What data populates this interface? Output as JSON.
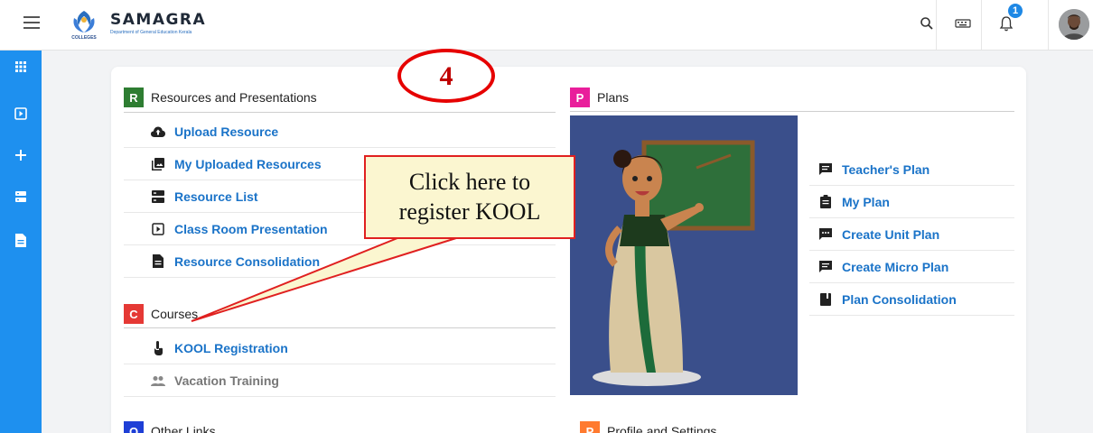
{
  "header": {
    "brand_title": "SAMAGRA",
    "brand_sub": "Department of General Education Kerala",
    "logo_caption": "COLLEGES",
    "notification_count": "1",
    "icons": [
      "search-icon",
      "keyboard-icon",
      "bell-icon"
    ]
  },
  "sidebar": {
    "items": [
      "apps-icon",
      "presentation-icon",
      "plus-icon",
      "list-icon",
      "document-icon"
    ]
  },
  "sections": {
    "resources": {
      "letter": "R",
      "title": "Resources and Presentations",
      "color": "#2e7d32"
    },
    "plans": {
      "letter": "P",
      "title": "Plans",
      "color": "#e91e9b"
    },
    "courses": {
      "letter": "C",
      "title": "Courses",
      "color": "#e53935"
    },
    "other": {
      "letter": "O",
      "title": "Other Links",
      "color": "#1e3fd6"
    },
    "profile": {
      "letter": "P",
      "title": "Profile and Settings",
      "color": "#ff7a2f"
    }
  },
  "resources_links": [
    "Upload Resource",
    "My Uploaded Resources",
    "Resource List",
    "Class Room Presentation",
    "Resource Consolidation"
  ],
  "courses_links": [
    "KOOL Registration",
    "Vacation Training"
  ],
  "plans_links": [
    "Teacher's Plan",
    "My Plan",
    "Create Unit Plan",
    "Create Micro Plan",
    "Plan Consolidation"
  ],
  "annotation": {
    "step_number": "4",
    "callout_line1": "Click here to",
    "callout_line2": "register KOOL"
  },
  "colors": {
    "link": "#1a73c8",
    "sidebar": "#1e90ef",
    "annotation_red": "#e60000"
  }
}
